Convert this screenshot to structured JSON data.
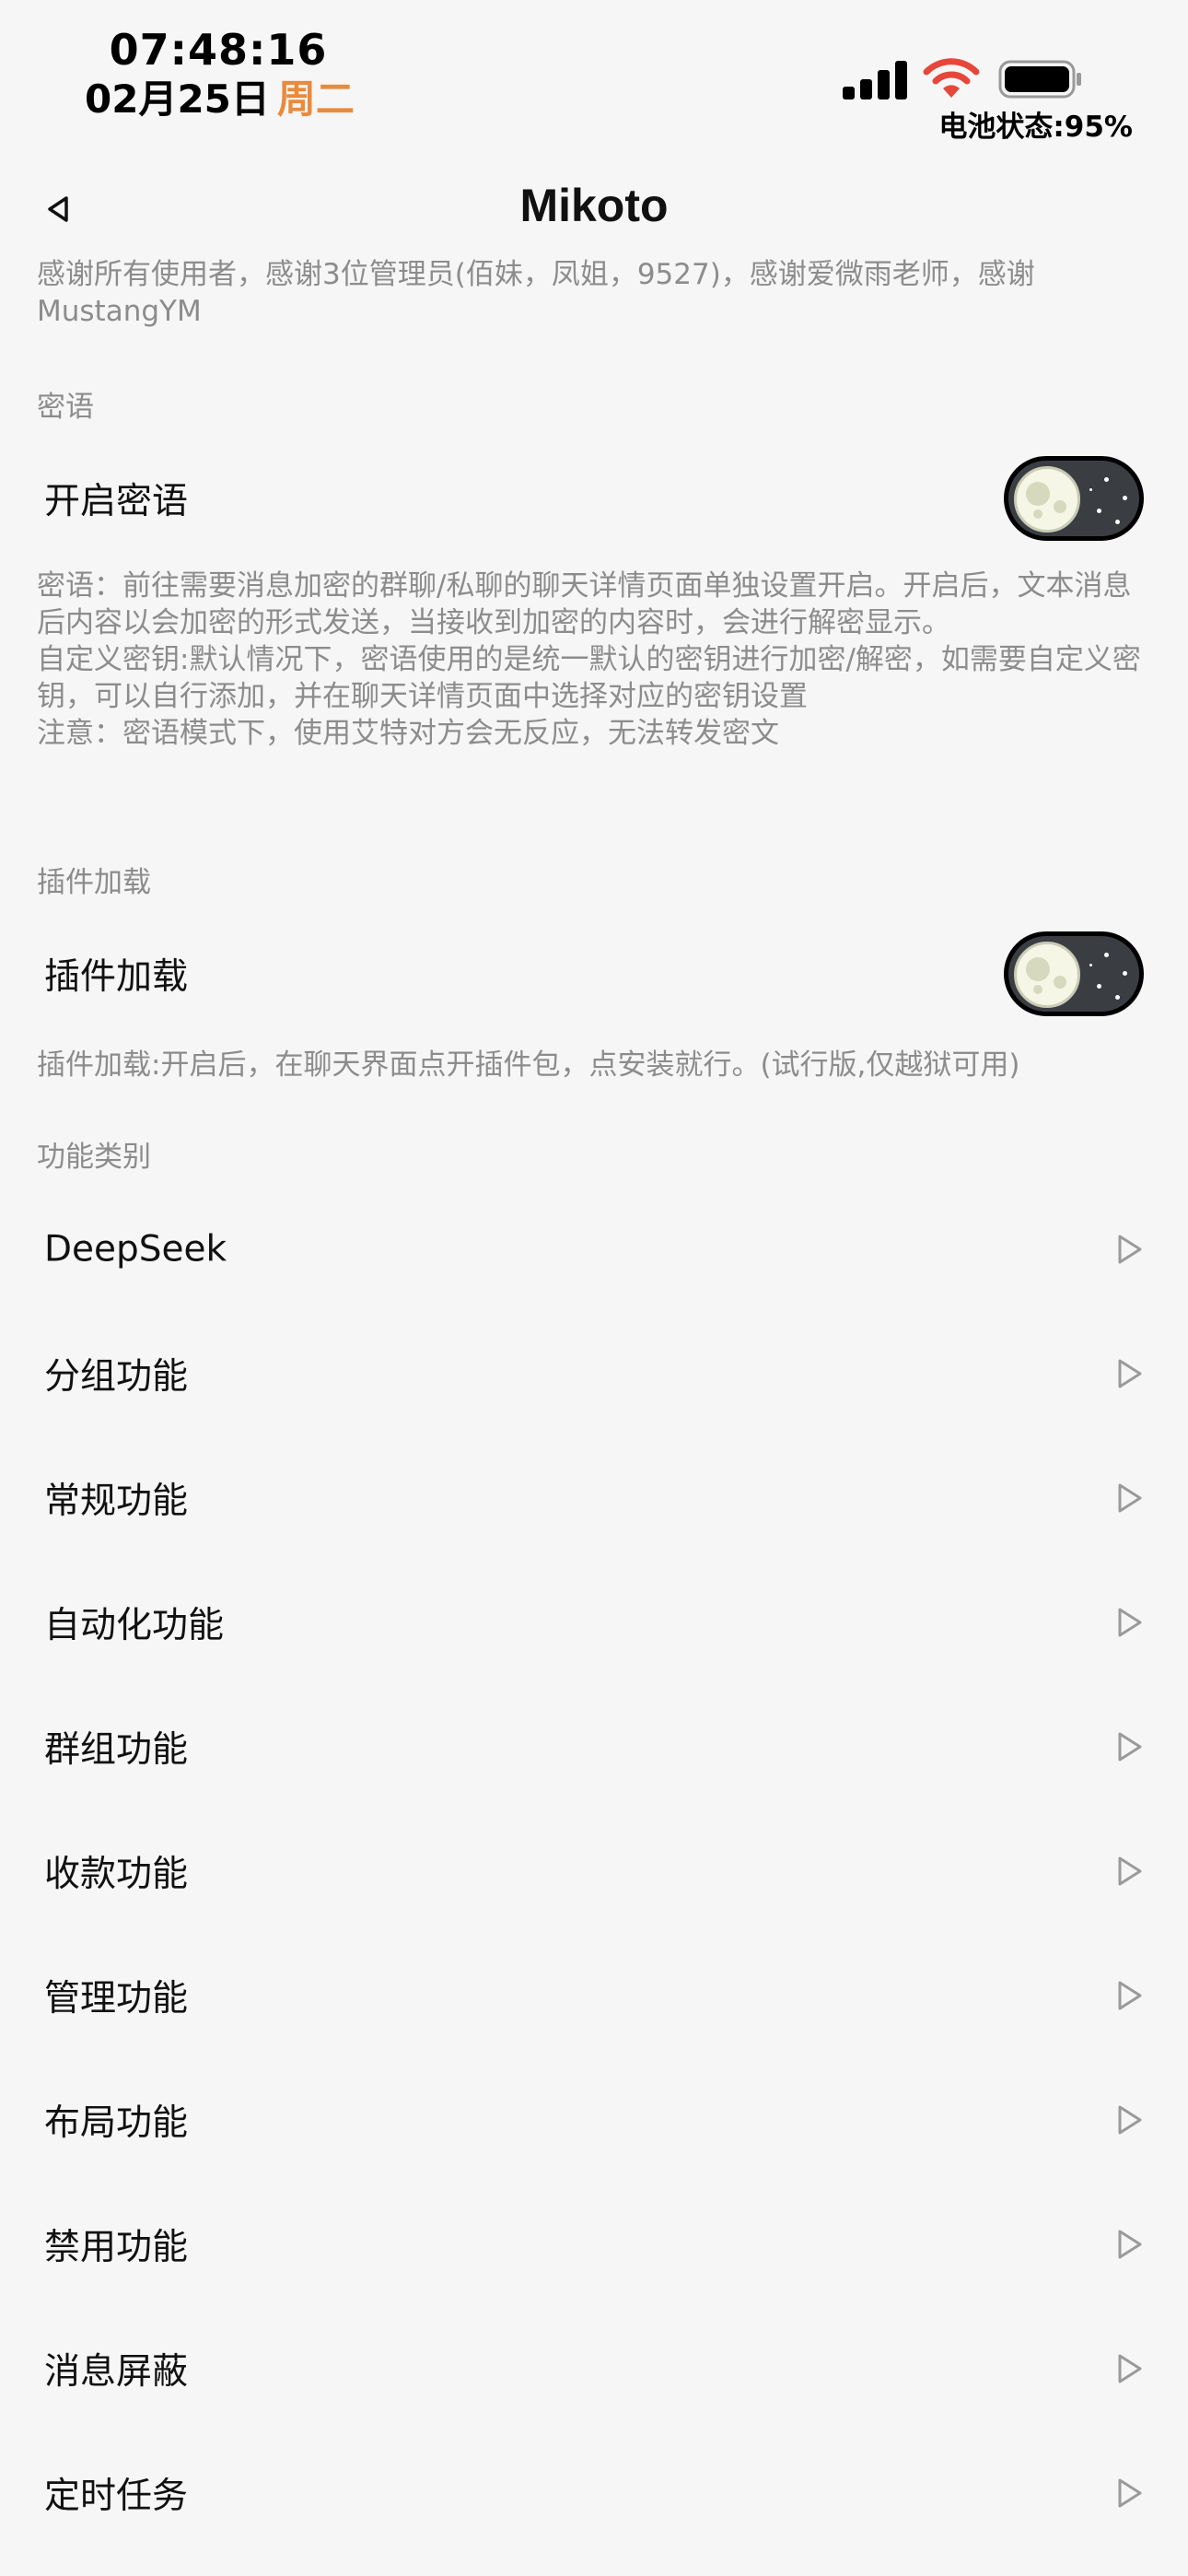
{
  "status_bar": {
    "time": "07:48:16",
    "date": "02月25日",
    "weekday": "周二",
    "battery_status": "电池状态:95%",
    "icons": [
      "cellular-signal-icon",
      "wifi-icon",
      "battery-icon"
    ],
    "wifi_color": "#e5483a",
    "weekday_color": "#e98a3c"
  },
  "nav": {
    "title": "Mikoto",
    "back_icon": "back-arrow-icon"
  },
  "intro_text": "感谢所有使用者，感谢3位管理员(佰妹，凤姐，9527)，感谢爱微雨老师，感谢MustangYM",
  "secret": {
    "section_title": "密语",
    "toggle_label": "开启密语",
    "toggle_on": true,
    "description_lines": [
      "密语：前往需要消息加密的群聊/私聊的聊天详情页面单独设置开启。开启后，文本消息后内容以会加密的形式发送，当接收到加密的内容时，会进行解密显示。",
      "自定义密钥:默认情况下，密语使用的是统一默认的密钥进行加密/解密，如需要自定义密钥，可以自行添加，并在聊天详情页面中选择对应的密钥设置",
      "注意：密语模式下，使用艾特对方会无反应，无法转发密文"
    ]
  },
  "plugin": {
    "section_title": "插件加载",
    "toggle_label": "插件加载",
    "toggle_on": true,
    "description": "插件加载:开启后，在聊天界面点开插件包，点安装就行。(试行版,仅越狱可用)"
  },
  "categories": {
    "section_title": "功能类别",
    "items": [
      {
        "label": "DeepSeek"
      },
      {
        "label": "分组功能"
      },
      {
        "label": "常规功能"
      },
      {
        "label": "自动化功能"
      },
      {
        "label": "群组功能"
      },
      {
        "label": "收款功能"
      },
      {
        "label": "管理功能"
      },
      {
        "label": "布局功能"
      },
      {
        "label": "禁用功能"
      },
      {
        "label": "消息屏蔽"
      },
      {
        "label": "定时任务"
      }
    ]
  }
}
